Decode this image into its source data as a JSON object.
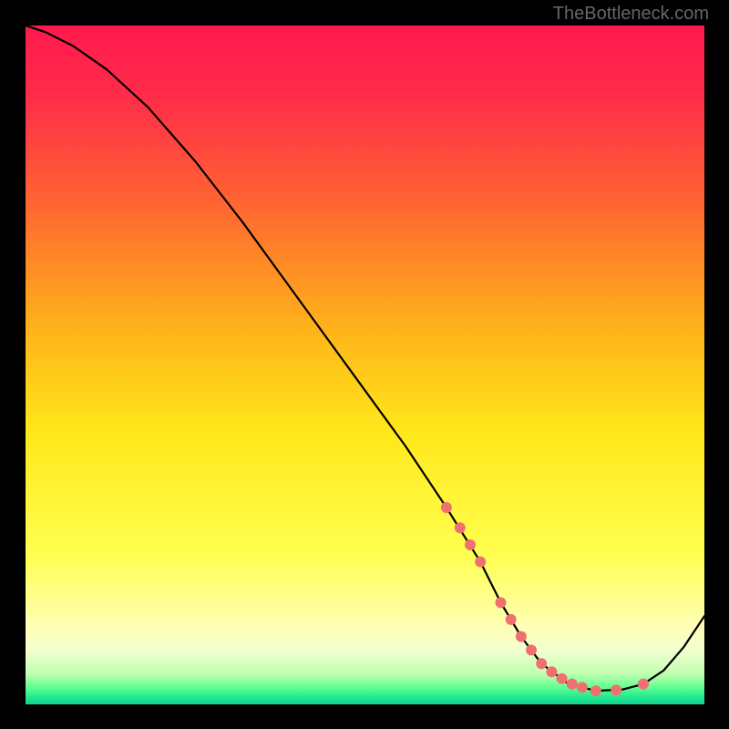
{
  "watermark": "TheBottleneck.com",
  "chart_data": {
    "type": "line",
    "title": "",
    "xlabel": "",
    "ylabel": "",
    "xlim": [
      0,
      100
    ],
    "ylim": [
      0,
      100
    ],
    "grid": false,
    "legend": false,
    "background_gradient": {
      "type": "vertical",
      "stops": [
        {
          "offset": 0.0,
          "color": "#ff1a4d"
        },
        {
          "offset": 0.1,
          "color": "#ff2b4a"
        },
        {
          "offset": 0.25,
          "color": "#ff6033"
        },
        {
          "offset": 0.45,
          "color": "#ffb41a"
        },
        {
          "offset": 0.6,
          "color": "#ffe81a"
        },
        {
          "offset": 0.78,
          "color": "#ffff50"
        },
        {
          "offset": 0.88,
          "color": "#ffffb0"
        },
        {
          "offset": 0.92,
          "color": "#f4ffd0"
        },
        {
          "offset": 0.955,
          "color": "#c0ffb0"
        },
        {
          "offset": 0.975,
          "color": "#60ff90"
        },
        {
          "offset": 0.99,
          "color": "#20e890"
        },
        {
          "offset": 1.0,
          "color": "#10d090"
        }
      ]
    },
    "series": [
      {
        "name": "curve",
        "x": [
          0,
          3,
          7,
          12,
          18,
          25,
          32,
          40,
          48,
          56,
          62,
          67,
          70,
          73,
          76,
          80,
          84,
          88,
          91,
          94,
          97,
          100
        ],
        "y": [
          100,
          99,
          97,
          93.5,
          88,
          80,
          71,
          60,
          49,
          38,
          29,
          21,
          15,
          10,
          6,
          3,
          2,
          2.2,
          3.0,
          5.0,
          8.5,
          13
        ]
      }
    ],
    "markers": {
      "name": "dots",
      "x": [
        62,
        64,
        65.5,
        67,
        70,
        71.5,
        73,
        74.5,
        76,
        77.5,
        79,
        80.5,
        82,
        84,
        87,
        91
      ],
      "y": [
        29,
        26,
        23.5,
        21,
        15,
        12.5,
        10,
        8,
        6,
        4.8,
        3.8,
        3.0,
        2.5,
        2,
        2.1,
        3.0
      ],
      "color": "#f07070",
      "radius": 6
    }
  }
}
